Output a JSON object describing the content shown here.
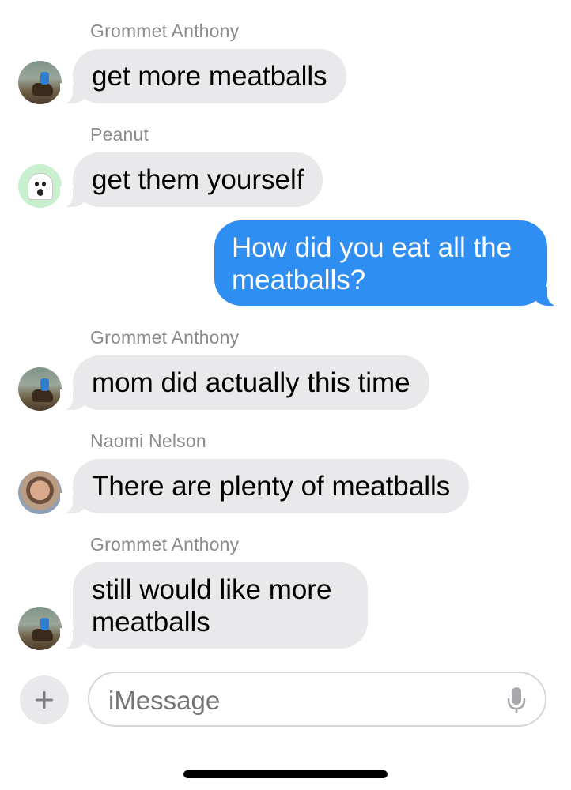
{
  "messages": [
    {
      "sender": "Grommet Anthony",
      "text": "get more meatballs"
    },
    {
      "sender": "Peanut",
      "text": "get them yourself"
    },
    {
      "sender": "",
      "text": "How did you eat all the meatballs?"
    },
    {
      "sender": "Grommet Anthony",
      "text": "mom did actually this time"
    },
    {
      "sender": "Naomi Nelson",
      "text": "There are plenty of meatballs"
    },
    {
      "sender": "Grommet Anthony",
      "text": "still would like more meatballs"
    }
  ],
  "outgoing_color": "#2f8ef2",
  "incoming_color": "#e9e9eb",
  "peanut_avatar_color": "#c9f0ce",
  "composer": {
    "placeholder": "iMessage",
    "add_icon": "plus-icon",
    "mic_icon": "microphone-icon"
  }
}
